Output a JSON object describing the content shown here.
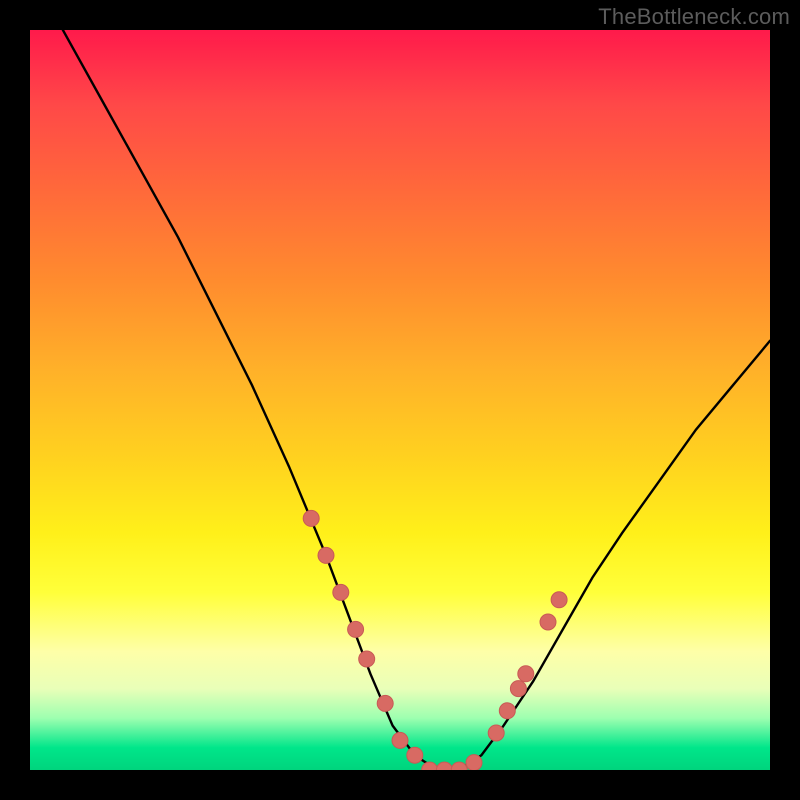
{
  "watermark": "TheBottleneck.com",
  "colors": {
    "curve": "#000000",
    "marker_fill": "#d86a63",
    "marker_stroke": "#c85a55",
    "background_black": "#000000"
  },
  "chart_data": {
    "type": "line",
    "title": "",
    "xlabel": "",
    "ylabel": "",
    "xlim": [
      0,
      100
    ],
    "ylim": [
      0,
      100
    ],
    "grid": false,
    "legend": false,
    "series": [
      {
        "name": "bottleneck-curve",
        "x": [
          0,
          5,
          10,
          15,
          20,
          25,
          30,
          35,
          40,
          43,
          46,
          49,
          52,
          55,
          58,
          61,
          64,
          68,
          72,
          76,
          80,
          85,
          90,
          95,
          100
        ],
        "values": [
          108,
          99,
          90,
          81,
          72,
          62,
          52,
          41,
          29,
          21,
          13,
          6,
          2,
          0,
          0,
          2,
          6,
          12,
          19,
          26,
          32,
          39,
          46,
          52,
          58
        ]
      }
    ],
    "markers": {
      "name": "highlight-points",
      "x": [
        38,
        40,
        42,
        44,
        45.5,
        48,
        50,
        52,
        54,
        56,
        58,
        60,
        63,
        64.5,
        66,
        67,
        70,
        71.5
      ],
      "values": [
        34,
        29,
        24,
        19,
        15,
        9,
        4,
        2,
        0,
        0,
        0,
        1,
        5,
        8,
        11,
        13,
        20,
        23
      ]
    }
  }
}
